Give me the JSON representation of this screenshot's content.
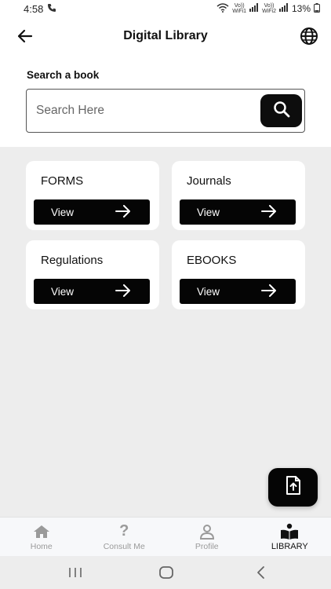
{
  "status_bar": {
    "time": "4:58",
    "sim1_top": "Vo))",
    "sim1_bottom": "WiFi1",
    "sim2_top": "Vo))",
    "sim2_bottom": "WiFi2",
    "battery": "13%"
  },
  "app_bar": {
    "title": "Digital Library",
    "back_icon": "arrow-left-icon",
    "globe_icon": "globe-icon"
  },
  "search": {
    "label": "Search a book",
    "placeholder": "Search Here",
    "value": "",
    "button_icon": "search-icon"
  },
  "cards": [
    {
      "title": "FORMS",
      "button_label": "View"
    },
    {
      "title": "Journals",
      "button_label": "View"
    },
    {
      "title": "Regulations",
      "button_label": "View"
    },
    {
      "title": "EBOOKS",
      "button_label": "View"
    }
  ],
  "fab": {
    "icon": "file-upload-icon"
  },
  "bottom_nav": {
    "items": [
      {
        "label": "Home",
        "icon": "home-icon",
        "active": false
      },
      {
        "label": "Consult Me",
        "icon": "question-mark-icon",
        "active": false
      },
      {
        "label": "Profile",
        "icon": "person-icon",
        "active": false
      },
      {
        "label": "LIBRARY",
        "icon": "book-reader-icon",
        "active": true
      }
    ]
  },
  "colors": {
    "primary": "#050505",
    "background": "#ededed",
    "surface": "#ffffff",
    "nav_inactive": "#9a9a9a"
  }
}
